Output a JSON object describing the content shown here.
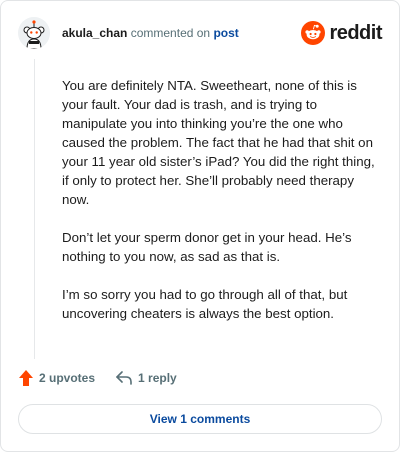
{
  "comment": {
    "username": "akula_chan",
    "action_text": "commented on",
    "post_link": "post",
    "avatar_icon": "snoo-avatar-icon",
    "paragraphs": [
      "You are definitely NTA. Sweetheart, none of this is your fault. Your dad is trash, and is trying to manipulate you into thinking you’re the one who caused the problem. The fact that he had that shit on your 11 year old sister’s iPad? You did the right thing, if only to protect her. She’ll probably need therapy now.",
      "Don’t let your sperm donor get in your head. He’s nothing to you now, as sad as that is.",
      "I’m so sorry you had to go through all of that, but uncovering cheaters is always the best option."
    ]
  },
  "brand": {
    "name": "reddit",
    "icon": "reddit-logo-icon",
    "color": "#ff4500"
  },
  "actions": {
    "upvotes_label": "2 upvotes",
    "reply_label": "1 reply",
    "upvote_icon": "upvote-arrow-icon",
    "reply_icon": "reply-arrow-icon",
    "upvote_color": "#ff4500"
  },
  "footer": {
    "view_comments_label": "View 1 comments"
  }
}
